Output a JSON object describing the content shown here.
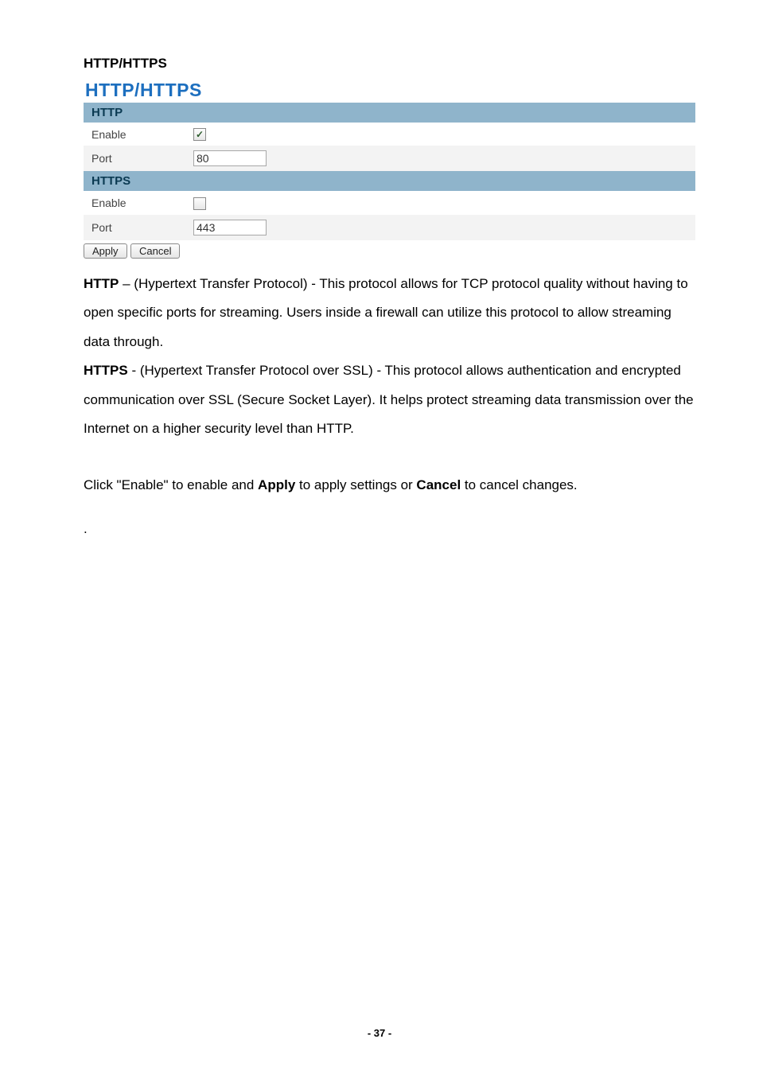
{
  "section_title": "HTTP/HTTPS",
  "panel": {
    "heading": "HTTP/HTTPS",
    "http": {
      "header": "HTTP",
      "enable_label": "Enable",
      "enable_checked": true,
      "port_label": "Port",
      "port_value": "80"
    },
    "https": {
      "header": "HTTPS",
      "enable_label": "Enable",
      "enable_checked": false,
      "port_label": "Port",
      "port_value": "443"
    },
    "apply_label": "Apply",
    "cancel_label": "Cancel"
  },
  "text": {
    "p1_strong": "HTTP",
    "p1_rest": " – (Hypertext Transfer Protocol) - This protocol allows for TCP protocol quality without having to open specific ports for streaming. Users inside a firewall can utilize this protocol to allow streaming data through.",
    "p2_strong": "HTTPS",
    "p2_rest": " - (Hypertext Transfer Protocol over SSL) - This protocol allows authentication and encrypted communication over SSL (Secure Socket Layer). It helps protect streaming data transmission over the Internet on a higher security level than HTTP.",
    "p3_a": "Click \"Enable\" to enable and ",
    "p3_b_strong": "Apply",
    "p3_c": " to apply settings or ",
    "p3_d_strong": "Cancel",
    "p3_e": " to cancel changes.",
    "dot": "."
  },
  "footer": "- 37 -"
}
